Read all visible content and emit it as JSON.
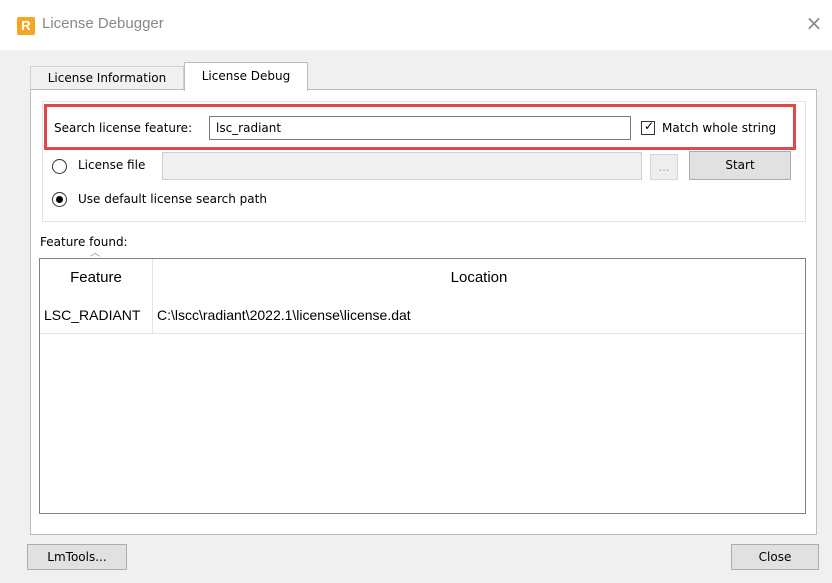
{
  "window": {
    "title": "License Debugger",
    "close_glyph": "×"
  },
  "tabs": [
    {
      "label": "License Information",
      "selected": false
    },
    {
      "label": "License Debug",
      "selected": true
    }
  ],
  "search": {
    "label": "Search license feature:",
    "value": "lsc_radiant",
    "match_whole_string": {
      "label": "Match whole string",
      "checked": true
    }
  },
  "license_file": {
    "label": "License file",
    "selected": false,
    "value": "",
    "browse_label": "..."
  },
  "default_path": {
    "label": "Use default license search path",
    "selected": true
  },
  "start_button": "Start",
  "results": {
    "label": "Feature found:",
    "columns": [
      "Feature",
      "Location"
    ],
    "rows": [
      {
        "feature": "LSC_RADIANT",
        "location": "C:\\lscc\\radiant\\2022.1\\license\\license.dat"
      }
    ]
  },
  "footer": {
    "lmtools_label": "LmTools...",
    "close_label": "Close"
  },
  "colors": {
    "highlight": "#e04848",
    "app_icon": "#f5a623"
  }
}
